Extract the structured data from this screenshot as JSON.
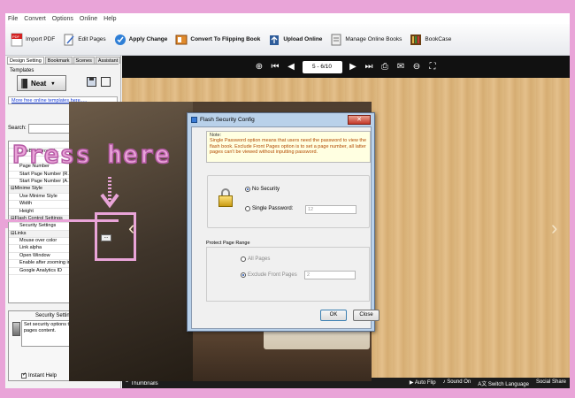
{
  "menu": [
    "File",
    "Convert",
    "Options",
    "Online",
    "Help"
  ],
  "toolbar": {
    "import_pdf": "Import PDF",
    "edit_pages": "Edit Pages",
    "apply_change": "Apply Change",
    "convert": "Convert To Flipping Book",
    "upload_online": "Upload Online",
    "manage_online": "Manage Online Books",
    "bookcase": "BookCase"
  },
  "left_panel": {
    "tabs": [
      "Design Setting",
      "Bookmark",
      "Scenes",
      "Assistant"
    ],
    "templates_label": "Templates",
    "template_name": "Neat",
    "more_templates": "More free online templates here.....",
    "search_label": "Search:",
    "search_value": "",
    "clear_label": "X",
    "properties": [
      {
        "k": "",
        "v": "No",
        "type": "item"
      },
      {
        "k": "...eeBackground...",
        "v": "...",
        "type": "item"
      },
      {
        "k": "",
        "v": "",
        "type": "item"
      },
      {
        "k": "Page Number",
        "v": "",
        "type": "item"
      },
      {
        "k": "Start Page Number (R...",
        "v": "1",
        "type": "item"
      },
      {
        "k": "Start Page Number (A...",
        "v": "3",
        "type": "item"
      },
      {
        "k": "⊟Minime Style",
        "v": "",
        "type": "sect"
      },
      {
        "k": "Use Minime Style",
        "v": "Yes",
        "type": "item"
      },
      {
        "k": "Width",
        "v": "400",
        "type": "item"
      },
      {
        "k": "Height",
        "v": "300",
        "type": "item"
      },
      {
        "k": "⊟Flash Control Settings",
        "v": "",
        "type": "sect"
      },
      {
        "k": "Security Settings",
        "v": "No Securit",
        "type": "item"
      },
      {
        "k": "⊟Links",
        "v": "",
        "type": "sect"
      },
      {
        "k": "Mouse over color",
        "v": "0x800080",
        "type": "color"
      },
      {
        "k": "Link alpha",
        "v": "0.2",
        "type": "item"
      },
      {
        "k": "Open Window",
        "v": "Blank",
        "type": "item"
      },
      {
        "k": "Enable after zooming in",
        "v": "Enable",
        "type": "item"
      },
      {
        "k": "Google Analytics ID",
        "v": "",
        "type": "item"
      }
    ],
    "help_title": "Security Settings",
    "help_text": "Set security options to protect the flash pages content.",
    "instant_help": "Instant Help"
  },
  "stage": {
    "page_indicator": "5 - 6/10",
    "thumbnails": "Thumbnails",
    "auto_flip": "Auto Flip",
    "sound_on": "Sound On",
    "switch_language": "Switch Language",
    "social_share": "Social Share"
  },
  "dialog": {
    "title": "Flash Security Config",
    "note_title": "Note:",
    "note_text": "Single Password option means that users need the password to view the flash book. Exclude Front Pages option is to set a page number, all latter pages can't be viewed without inputting password.",
    "no_security": "No Security",
    "single_password": "Single Password:",
    "password_value": "12",
    "protect_range": "Protect Page Range",
    "all_pages": "All Pages",
    "exclude_front": "Exclude Front Pages",
    "exclude_value": "2",
    "ok": "OK",
    "close": "Close"
  },
  "annotation": {
    "text": "Press here",
    "browse": "..."
  }
}
